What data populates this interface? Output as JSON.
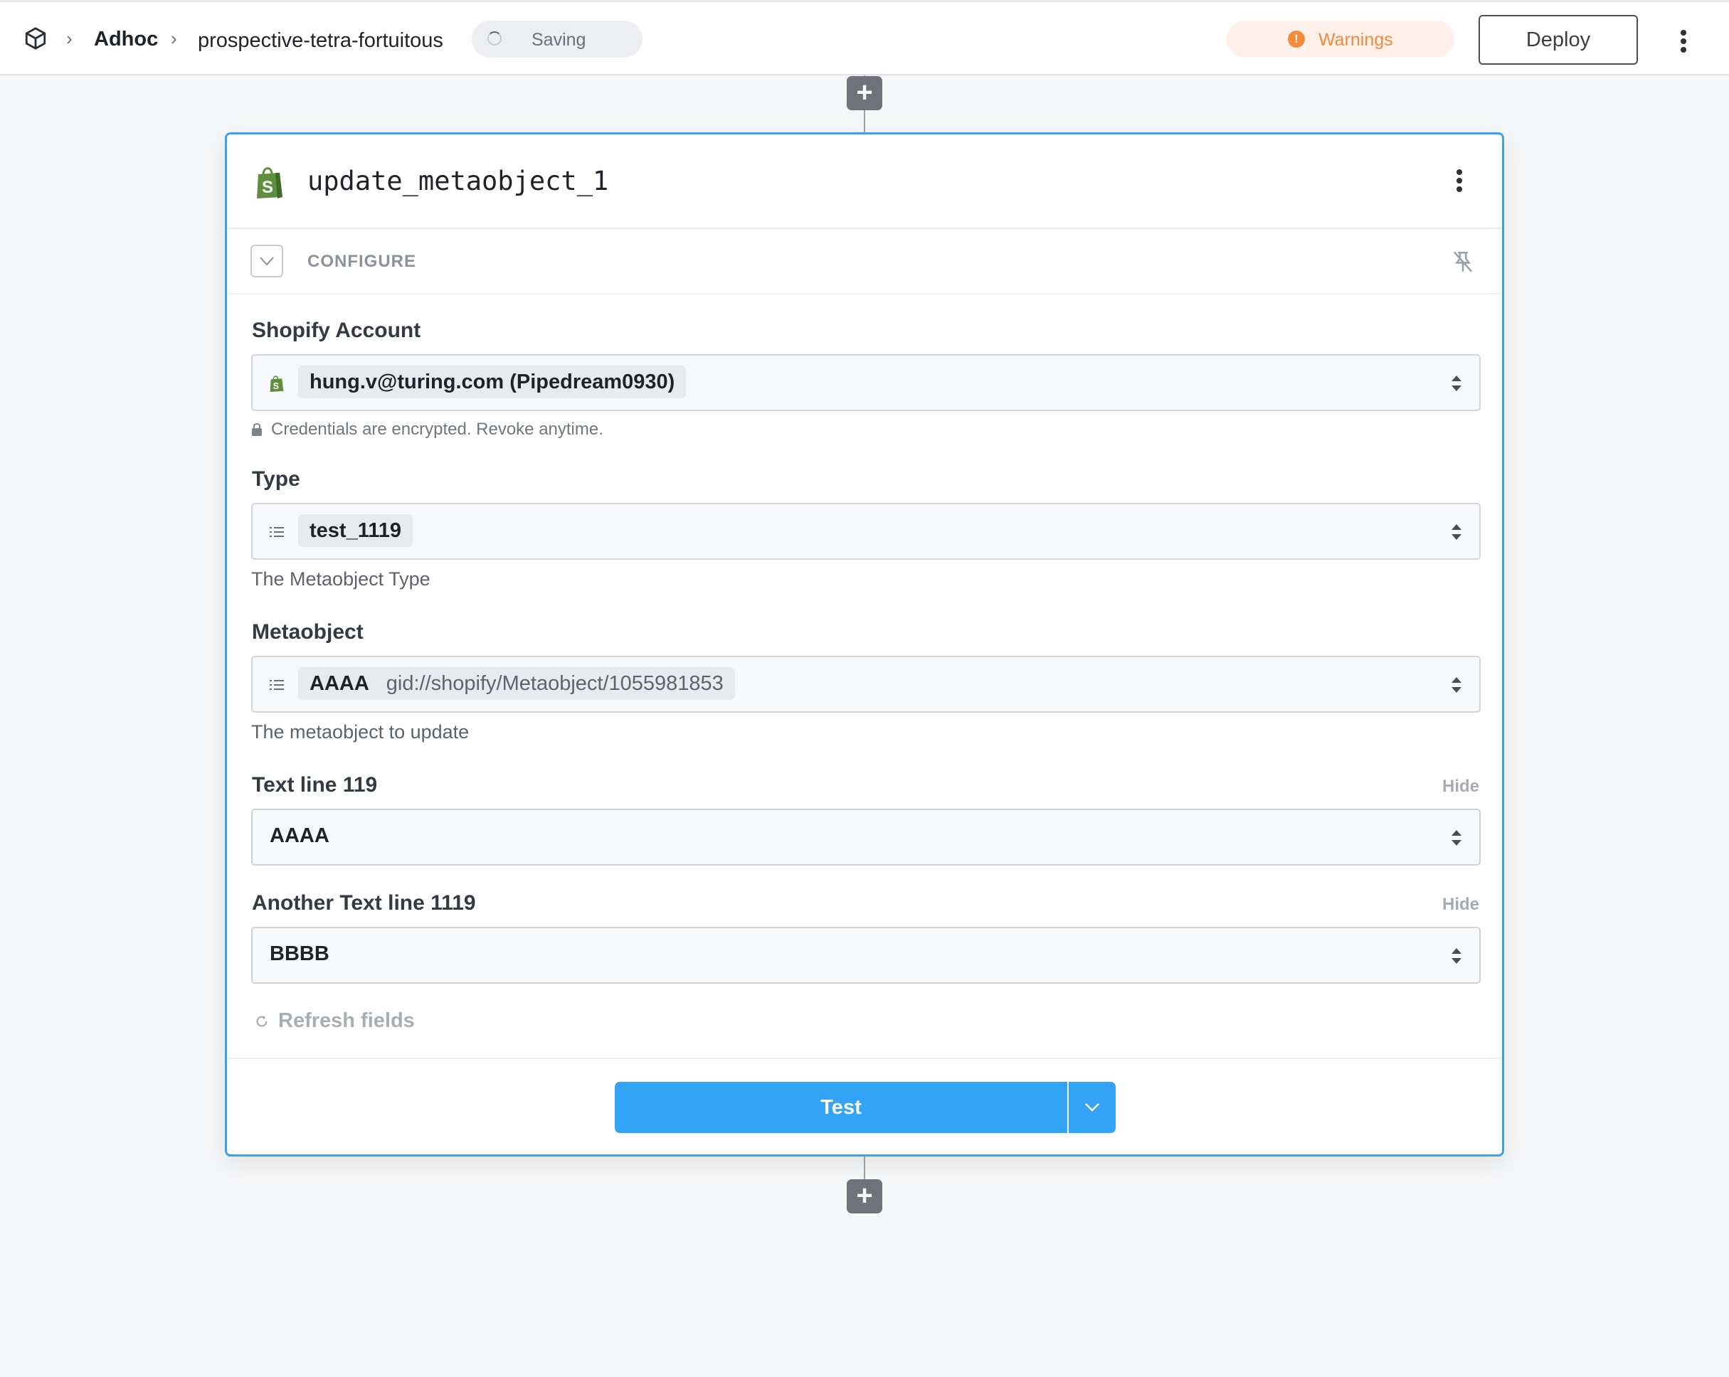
{
  "topbar": {
    "workspace": "Adhoc",
    "project": "prospective-tetra-fortuitous",
    "status": "Saving",
    "warnings_label": "Warnings",
    "deploy_label": "Deploy"
  },
  "step": {
    "name": "update_metaobject_1",
    "configure_label": "CONFIGURE",
    "fields": {
      "account": {
        "label": "Shopify Account",
        "value": "hung.v@turing.com (Pipedream0930)",
        "note": "Credentials are encrypted. Revoke anytime."
      },
      "type": {
        "label": "Type",
        "value": "test_1119",
        "help": "The Metaobject Type"
      },
      "metaobject": {
        "label": "Metaobject",
        "value": "AAAA",
        "value_id": "gid://shopify/Metaobject/1055981853",
        "help": "The metaobject to update"
      },
      "text_line": {
        "label": "Text line 119",
        "hide_label": "Hide",
        "value": "AAAA"
      },
      "another_text_line": {
        "label": "Another Text line 1119",
        "hide_label": "Hide",
        "value": "BBBB"
      }
    },
    "refresh_label": "Refresh fields",
    "test_label": "Test"
  },
  "colors": {
    "accent": "#33a3f5",
    "card_border": "#3fa0ef",
    "warning": "#f08a3a",
    "shopify_green": "#5e8e3e"
  },
  "icons": [
    "cube-icon",
    "chevron-right-icon",
    "spinner-icon",
    "warning-icon",
    "kebab-icon",
    "plus-icon",
    "shopify-icon",
    "chevron-down-icon",
    "pin-off-icon",
    "lock-icon",
    "list-icon",
    "updown-icon",
    "refresh-icon"
  ]
}
